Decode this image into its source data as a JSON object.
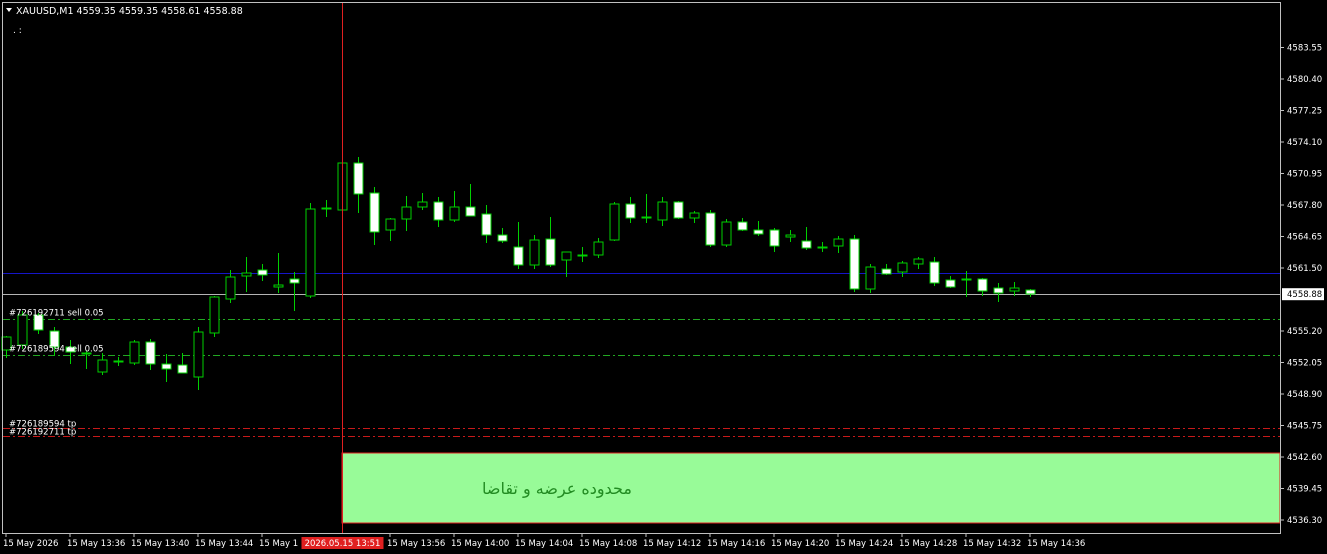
{
  "header": {
    "symbol_line": "XAUUSD,M1  4559.35 4559.35 4558.61 4558.88",
    "dots": ". :"
  },
  "chart_data": {
    "type": "candlestick",
    "symbol": "XAUUSD",
    "timeframe": "M1",
    "ylim": [
      4535.0,
      4588.0
    ],
    "y_ticks": [
      "4583.55",
      "4580.40",
      "4577.25",
      "4574.10",
      "4570.95",
      "4567.80",
      "4564.65",
      "4561.50",
      "4555.20",
      "4552.05",
      "4548.90",
      "4545.75",
      "4542.60",
      "4539.45",
      "4536.30"
    ],
    "x_ticks": [
      {
        "label": "15 May 2026",
        "i": 0
      },
      {
        "label": "15 May 13:36",
        "i": 4
      },
      {
        "label": "15 May 13:40",
        "i": 8
      },
      {
        "label": "15 May 13:44",
        "i": 12
      },
      {
        "label": "15 May 1",
        "i": 16
      },
      {
        "label": "15 May 13:56",
        "i": 24
      },
      {
        "label": "15 May 14:00",
        "i": 28
      },
      {
        "label": "15 May 14:04",
        "i": 32
      },
      {
        "label": "15 May 14:08",
        "i": 36
      },
      {
        "label": "15 May 14:12",
        "i": 40
      },
      {
        "label": "15 May 14:16",
        "i": 44
      },
      {
        "label": "15 May 14:20",
        "i": 48
      },
      {
        "label": "15 May 14:24",
        "i": 52
      },
      {
        "label": "15 May 14:28",
        "i": 56
      },
      {
        "label": "15 May 14:32",
        "i": 60
      },
      {
        "label": "15 May 14:36",
        "i": 64
      }
    ],
    "crosshair_time_label": "2026.05.15 13:51",
    "crosshair_index": 21,
    "candles": [
      {
        "o": 4553.3,
        "h": 4554.7,
        "l": 4552.5,
        "c": 4554.6
      },
      {
        "o": 4553.8,
        "h": 4557.2,
        "l": 4553.4,
        "c": 4556.8
      },
      {
        "o": 4556.8,
        "h": 4557.0,
        "l": 4554.9,
        "c": 4555.3
      },
      {
        "o": 4555.2,
        "h": 4555.6,
        "l": 4552.7,
        "c": 4553.6
      },
      {
        "o": 4553.6,
        "h": 4554.3,
        "l": 4551.9,
        "c": 4553.1
      },
      {
        "o": 4553.0,
        "h": 4553.2,
        "l": 4551.4,
        "c": 4552.9
      },
      {
        "o": 4551.1,
        "h": 4553.0,
        "l": 4550.8,
        "c": 4552.3
      },
      {
        "o": 4552.2,
        "h": 4552.6,
        "l": 4551.7,
        "c": 4552.2
      },
      {
        "o": 4552.0,
        "h": 4554.3,
        "l": 4551.8,
        "c": 4554.1
      },
      {
        "o": 4554.1,
        "h": 4554.4,
        "l": 4551.3,
        "c": 4551.9
      },
      {
        "o": 4551.9,
        "h": 4552.9,
        "l": 4550.1,
        "c": 4551.4
      },
      {
        "o": 4551.8,
        "h": 4553.0,
        "l": 4551.0,
        "c": 4551.0
      },
      {
        "o": 4550.6,
        "h": 4555.6,
        "l": 4549.3,
        "c": 4555.1
      },
      {
        "o": 4555.0,
        "h": 4558.7,
        "l": 4554.6,
        "c": 4558.6
      },
      {
        "o": 4558.4,
        "h": 4561.3,
        "l": 4558.0,
        "c": 4560.6
      },
      {
        "o": 4560.7,
        "h": 4562.6,
        "l": 4559.1,
        "c": 4561.0
      },
      {
        "o": 4561.3,
        "h": 4561.9,
        "l": 4560.2,
        "c": 4560.8
      },
      {
        "o": 4559.6,
        "h": 4563.0,
        "l": 4559.0,
        "c": 4559.8
      },
      {
        "o": 4560.4,
        "h": 4561.1,
        "l": 4557.2,
        "c": 4560.0
      },
      {
        "o": 4558.7,
        "h": 4568.0,
        "l": 4558.5,
        "c": 4567.4
      },
      {
        "o": 4567.4,
        "h": 4568.3,
        "l": 4566.6,
        "c": 4567.5
      },
      {
        "o": 4567.3,
        "h": 4572.9,
        "l": 4566.0,
        "c": 4572.0
      },
      {
        "o": 4572.0,
        "h": 4572.6,
        "l": 4567.0,
        "c": 4568.9
      },
      {
        "o": 4569.0,
        "h": 4569.6,
        "l": 4563.8,
        "c": 4565.1
      },
      {
        "o": 4565.3,
        "h": 4566.5,
        "l": 4564.2,
        "c": 4566.4
      },
      {
        "o": 4566.4,
        "h": 4568.7,
        "l": 4565.2,
        "c": 4567.6
      },
      {
        "o": 4567.6,
        "h": 4569.0,
        "l": 4567.3,
        "c": 4568.1
      },
      {
        "o": 4568.1,
        "h": 4568.6,
        "l": 4565.6,
        "c": 4566.3
      },
      {
        "o": 4566.3,
        "h": 4569.2,
        "l": 4566.1,
        "c": 4567.6
      },
      {
        "o": 4567.6,
        "h": 4569.9,
        "l": 4566.7,
        "c": 4566.7
      },
      {
        "o": 4566.9,
        "h": 4567.8,
        "l": 4564.0,
        "c": 4564.8
      },
      {
        "o": 4564.8,
        "h": 4565.5,
        "l": 4564.0,
        "c": 4564.2
      },
      {
        "o": 4563.6,
        "h": 4566.1,
        "l": 4561.4,
        "c": 4561.8
      },
      {
        "o": 4561.8,
        "h": 4564.8,
        "l": 4561.4,
        "c": 4564.3
      },
      {
        "o": 4564.4,
        "h": 4566.6,
        "l": 4561.6,
        "c": 4561.8
      },
      {
        "o": 4562.3,
        "h": 4563.1,
        "l": 4560.6,
        "c": 4563.1
      },
      {
        "o": 4562.8,
        "h": 4563.6,
        "l": 4562.1,
        "c": 4562.8
      },
      {
        "o": 4562.8,
        "h": 4564.5,
        "l": 4562.5,
        "c": 4564.1
      },
      {
        "o": 4564.3,
        "h": 4568.1,
        "l": 4564.2,
        "c": 4567.9
      },
      {
        "o": 4567.9,
        "h": 4568.6,
        "l": 4566.0,
        "c": 4566.5
      },
      {
        "o": 4566.5,
        "h": 4568.9,
        "l": 4566.0,
        "c": 4566.6
      },
      {
        "o": 4566.3,
        "h": 4568.6,
        "l": 4565.7,
        "c": 4568.1
      },
      {
        "o": 4568.1,
        "h": 4568.2,
        "l": 4566.4,
        "c": 4566.5
      },
      {
        "o": 4566.5,
        "h": 4567.2,
        "l": 4566.0,
        "c": 4567.0
      },
      {
        "o": 4567.0,
        "h": 4567.3,
        "l": 4563.6,
        "c": 4563.8
      },
      {
        "o": 4563.8,
        "h": 4566.4,
        "l": 4563.6,
        "c": 4566.1
      },
      {
        "o": 4566.1,
        "h": 4566.5,
        "l": 4565.2,
        "c": 4565.3
      },
      {
        "o": 4565.3,
        "h": 4566.2,
        "l": 4564.7,
        "c": 4564.9
      },
      {
        "o": 4565.3,
        "h": 4565.5,
        "l": 4563.1,
        "c": 4563.7
      },
      {
        "o": 4564.6,
        "h": 4565.3,
        "l": 4564.1,
        "c": 4564.8
      },
      {
        "o": 4564.2,
        "h": 4565.6,
        "l": 4563.3,
        "c": 4563.5
      },
      {
        "o": 4563.5,
        "h": 4564.1,
        "l": 4563.1,
        "c": 4563.6
      },
      {
        "o": 4563.7,
        "h": 4564.7,
        "l": 4563.0,
        "c": 4564.4
      },
      {
        "o": 4564.4,
        "h": 4564.8,
        "l": 4559.1,
        "c": 4559.4
      },
      {
        "o": 4559.4,
        "h": 4561.9,
        "l": 4559.0,
        "c": 4561.6
      },
      {
        "o": 4561.4,
        "h": 4561.9,
        "l": 4560.8,
        "c": 4560.9
      },
      {
        "o": 4561.1,
        "h": 4562.2,
        "l": 4560.6,
        "c": 4562.0
      },
      {
        "o": 4561.9,
        "h": 4562.6,
        "l": 4561.4,
        "c": 4562.4
      },
      {
        "o": 4562.1,
        "h": 4562.6,
        "l": 4559.7,
        "c": 4560.0
      },
      {
        "o": 4560.3,
        "h": 4560.7,
        "l": 4559.5,
        "c": 4559.6
      },
      {
        "o": 4560.4,
        "h": 4561.2,
        "l": 4558.6,
        "c": 4560.4
      },
      {
        "o": 4560.4,
        "h": 4560.5,
        "l": 4558.7,
        "c": 4559.2
      },
      {
        "o": 4559.5,
        "h": 4560.0,
        "l": 4558.1,
        "c": 4559.0
      },
      {
        "o": 4559.2,
        "h": 4560.1,
        "l": 4558.7,
        "c": 4559.5
      },
      {
        "o": 4559.3,
        "h": 4559.4,
        "l": 4558.6,
        "c": 4558.9
      }
    ],
    "hlines": [
      {
        "price": 4561.0,
        "style": "solid",
        "color": "#1515c8"
      },
      {
        "price": 4558.88,
        "style": "solid",
        "color": "#b4b4b4"
      },
      {
        "price": 4556.4,
        "style": "dashdot",
        "color": "#22a722",
        "label": "#726192711 sell 0.05"
      },
      {
        "price": 4552.8,
        "style": "dashdot",
        "color": "#22a722",
        "label": "#726189594 sell 0.05"
      },
      {
        "price": 4545.5,
        "style": "dashdot",
        "color": "#c71a1a",
        "label": "#726189594 tp"
      },
      {
        "price": 4544.7,
        "style": "dashdot",
        "color": "#c71a1a",
        "label": "#726192711 tp"
      }
    ],
    "current_price_label": "4558.88",
    "zone": {
      "label": "محدوده عرضه و تقاضا",
      "price_top": 4543.0,
      "price_bottom": 4536.0,
      "start_index": 21,
      "fill": "#98fb98",
      "border": "#e02020",
      "text_color": "#228b22"
    },
    "colors": {
      "background": "#000000",
      "frame": "#c0c0c0",
      "bull_fill": "#000000",
      "bear_fill": "#ffffff",
      "candle_outline": "#00d000",
      "axis_text": "#ffffff",
      "crosshair": "#e02020"
    }
  }
}
